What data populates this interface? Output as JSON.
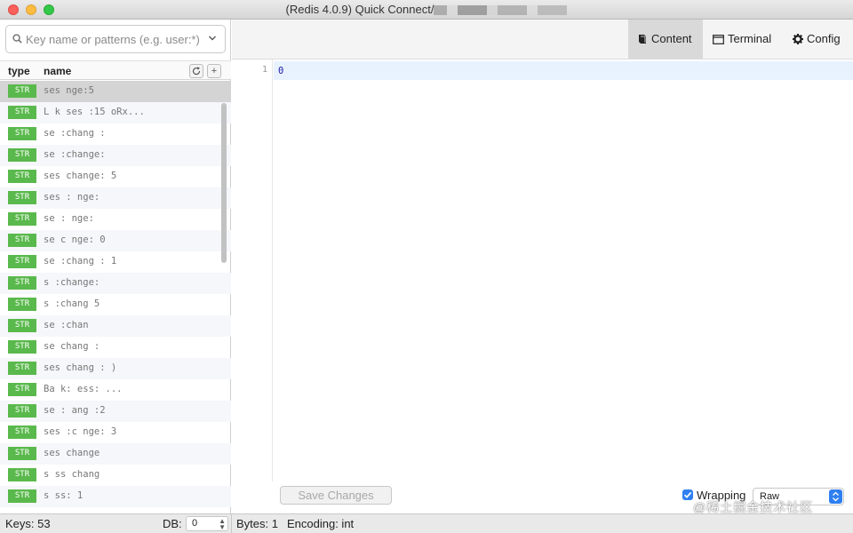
{
  "window": {
    "title": "(Redis 4.0.9) Quick Connect/"
  },
  "search": {
    "placeholder": "Key name or patterns (e.g. user:*)",
    "value": ""
  },
  "list_header": {
    "type_label": "type",
    "name_label": "name",
    "add_label": "+"
  },
  "keys": [
    {
      "type": "STR",
      "name": "ses   nge:5"
    },
    {
      "type": "STR",
      "name": "L  k ses :15     oRx..."
    },
    {
      "type": "STR",
      "name": "se  :chang :"
    },
    {
      "type": "STR",
      "name": "se  :change:"
    },
    {
      "type": "STR",
      "name": "ses  change: 5"
    },
    {
      "type": "STR",
      "name": "ses : nge:"
    },
    {
      "type": "STR",
      "name": "se  :  nge:"
    },
    {
      "type": "STR",
      "name": "se   c nge: 0"
    },
    {
      "type": "STR",
      "name": "se  :chang : 1"
    },
    {
      "type": "STR",
      "name": "s  :change:"
    },
    {
      "type": "STR",
      "name": "s  :chang  5"
    },
    {
      "type": "STR",
      "name": "se  :chan  "
    },
    {
      "type": "STR",
      "name": "se  chang  :"
    },
    {
      "type": "STR",
      "name": "ses  chang : )"
    },
    {
      "type": "STR",
      "name": "Ba k:  ess:     ..."
    },
    {
      "type": "STR",
      "name": "se  : ang :2"
    },
    {
      "type": "STR",
      "name": "ses :c nge: 3"
    },
    {
      "type": "STR",
      "name": "ses  change"
    },
    {
      "type": "STR",
      "name": "s ss chang  "
    },
    {
      "type": "STR",
      "name": "s ss:     1"
    }
  ],
  "toolbar": {
    "content_label": "Content",
    "terminal_label": "Terminal",
    "config_label": "Config"
  },
  "editor": {
    "line_number": "1",
    "value": "0"
  },
  "footer": {
    "save_label": "Save Changes",
    "wrapping_label": "Wrapping",
    "wrapping_checked": true,
    "format_value": "Raw",
    "watermark": "@稀土掘金技术社区"
  },
  "status": {
    "keys_text": "Keys: 53",
    "db_label": "DB:",
    "db_value": "0",
    "bytes_text": "Bytes: 1",
    "encoding_text": "Encoding: int"
  },
  "colors": {
    "badge_green": "#5ab94c",
    "accent_blue": "#2f7ff0",
    "selected_row": "#d4d4d4"
  }
}
